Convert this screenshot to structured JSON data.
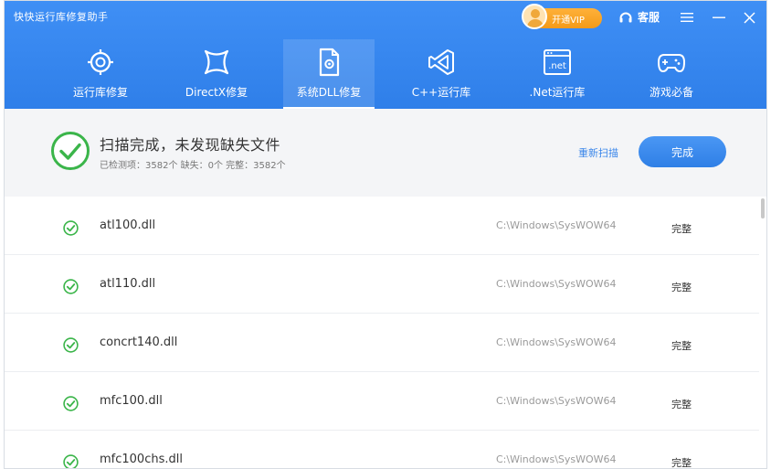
{
  "window": {
    "title": "快快运行库修复助手",
    "vip_label": "开通VIP",
    "service_label": "客服"
  },
  "tabs": [
    {
      "label": "运行库修复",
      "icon": "repair-icon",
      "active": false
    },
    {
      "label": "DirectX修复",
      "icon": "directx-icon",
      "active": false
    },
    {
      "label": "系统DLL修复",
      "icon": "dll-icon",
      "active": true
    },
    {
      "label": "C++运行库",
      "icon": "cpp-icon",
      "active": false
    },
    {
      "label": ".Net运行库",
      "icon": "dotnet-icon",
      "active": false
    },
    {
      "label": "游戏必备",
      "icon": "gamepad-icon",
      "active": false
    }
  ],
  "dotnet_icon_text": ".net",
  "status": {
    "title": "扫描完成，未发现缺失文件",
    "summary": "已检测项：3582个  缺失：0个  完整：3582个",
    "rescan_label": "重新扫描",
    "done_label": "完成"
  },
  "files": [
    {
      "name": "atl100.dll",
      "path": "C:\\Windows\\SysWOW64",
      "status": "完整"
    },
    {
      "name": "atl110.dll",
      "path": "C:\\Windows\\SysWOW64",
      "status": "完整"
    },
    {
      "name": "concrt140.dll",
      "path": "C:\\Windows\\SysWOW64",
      "status": "完整"
    },
    {
      "name": "mfc100.dll",
      "path": "C:\\Windows\\SysWOW64",
      "status": "完整"
    },
    {
      "name": "mfc100chs.dll",
      "path": "C:\\Windows\\SysWOW64",
      "status": "完整"
    }
  ],
  "colors": {
    "header_blue": "#2f7fe9",
    "success_green": "#3bb54a",
    "vip_orange": "#f39a18",
    "link_blue": "#3a86ea"
  }
}
